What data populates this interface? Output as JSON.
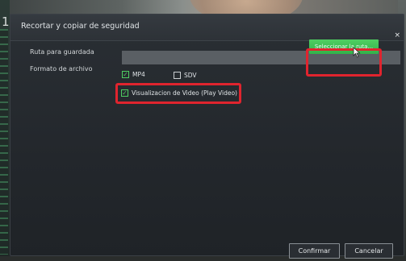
{
  "screen": {
    "bezel_digit": "1"
  },
  "dialog": {
    "title": "Recortar y copiar de seguridad",
    "close_symbol": "×",
    "path_label": "Ruta para guardada",
    "path_value": "",
    "select_path_label": "Seleccionar la ruta...",
    "format_label": "Formato de archivo",
    "formats": [
      {
        "label": "MP4",
        "checked": true
      },
      {
        "label": "SDV",
        "checked": false
      }
    ],
    "play_video": {
      "label": "Visualizacion de Video (Play Video)",
      "checked": true
    },
    "confirm_label": "Confirmar",
    "cancel_label": "Cancelar"
  },
  "colors": {
    "accent": "#3fc156",
    "highlight": "#e0242e",
    "dialog_bg": "#252a2f"
  },
  "icons": {
    "close": "close-icon",
    "cursor": "mouse-pointer-icon",
    "check": "checkmark-icon"
  }
}
